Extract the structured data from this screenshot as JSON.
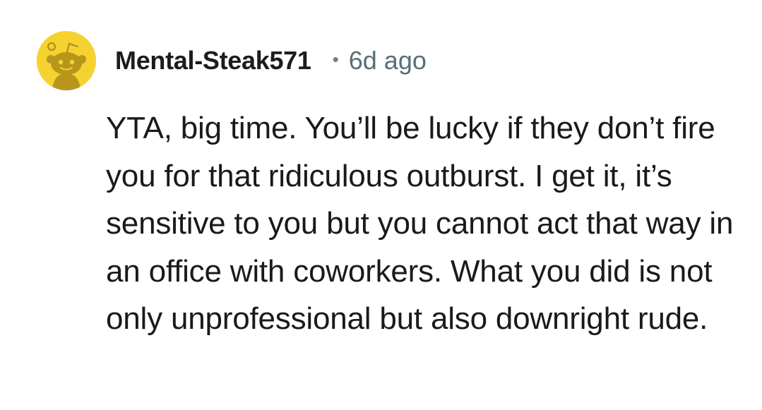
{
  "comment": {
    "author": "Mental-Steak571",
    "separator": "•",
    "timestamp": "6d ago",
    "avatar_icon": "snoo-avatar-icon",
    "avatar_color": "#f5d22f",
    "body": "YTA, big time. You’ll be lucky if they don’t fire you for that ridiculous outburst. I get it, it’s sensitive to you but you cannot act that way in an office with coworkers. What you did is not only unprofessional but also downright rude."
  }
}
